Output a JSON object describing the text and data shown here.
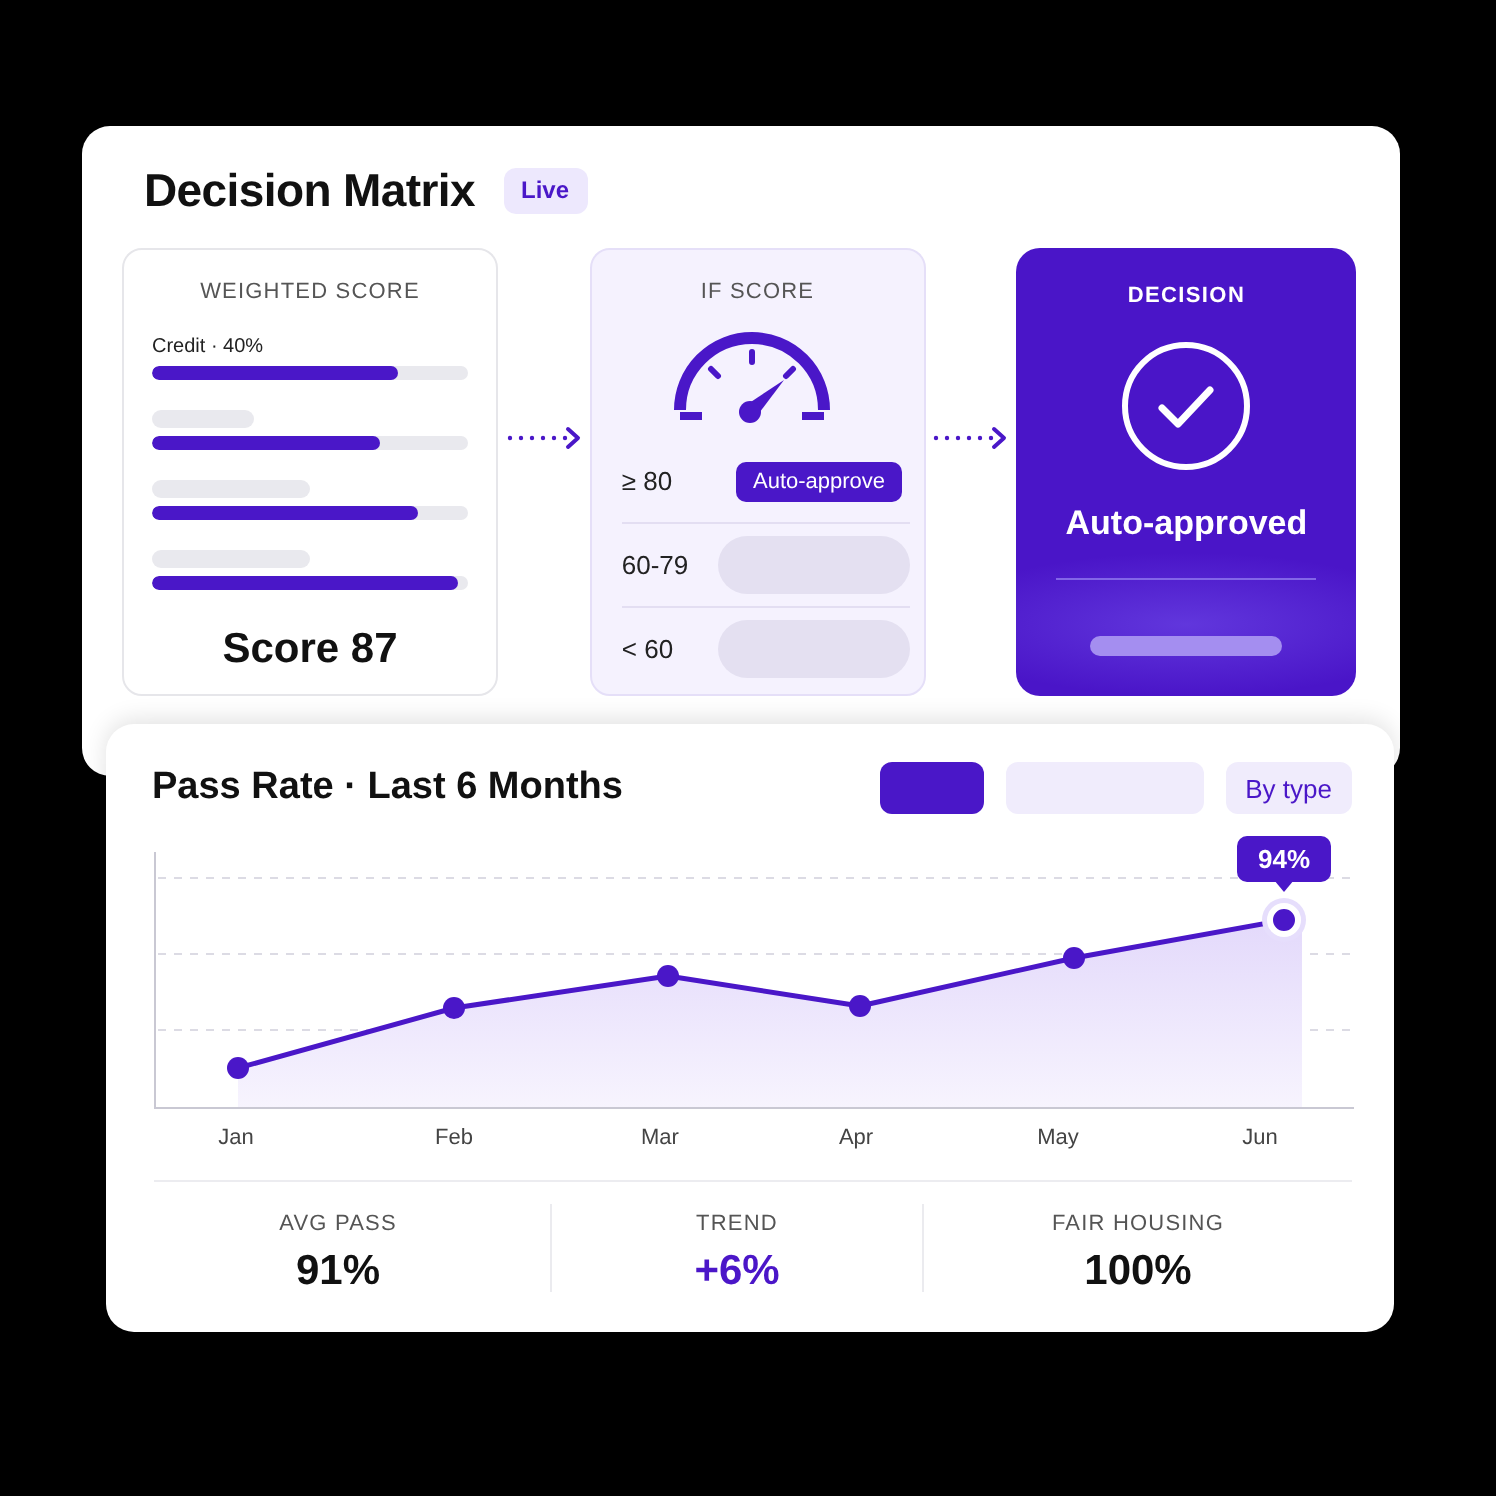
{
  "decision_matrix": {
    "title": "Decision Matrix",
    "badge": "Live",
    "weighted_score": {
      "title": "WEIGHTED SCORE",
      "factors": [
        {
          "label": "Credit · 40%",
          "level": 0.78
        },
        {
          "level": 0.72
        },
        {
          "level": 0.84
        },
        {
          "level": 0.97
        }
      ],
      "score": "Score 87"
    },
    "if_score": {
      "title": "IF SCORE",
      "rules": [
        {
          "condition": "≥ 80",
          "outcome": "Auto-approve"
        },
        {
          "condition": "60-79"
        },
        {
          "condition": "< 60"
        }
      ]
    },
    "decision": {
      "title": "DECISION",
      "result": "Auto-approved"
    }
  },
  "pass_rate": {
    "title": "Pass Rate · Last 6 Months",
    "filters": [
      {
        "selected": true
      },
      {
        "selected": false
      },
      {
        "label": "By type",
        "selected": false
      }
    ],
    "chart": {
      "months": [
        "Jan",
        "Feb",
        "Mar",
        "Apr",
        "May",
        "Jun"
      ],
      "peak_label": "94%"
    },
    "stats": [
      {
        "label": "AVG PASS",
        "value": "91%",
        "color": "#111111"
      },
      {
        "label": "TREND",
        "value": "+6%",
        "color": "#4b16c8"
      },
      {
        "label": "FAIR HOUSING",
        "value": "100%",
        "color": "#111111"
      }
    ]
  }
}
